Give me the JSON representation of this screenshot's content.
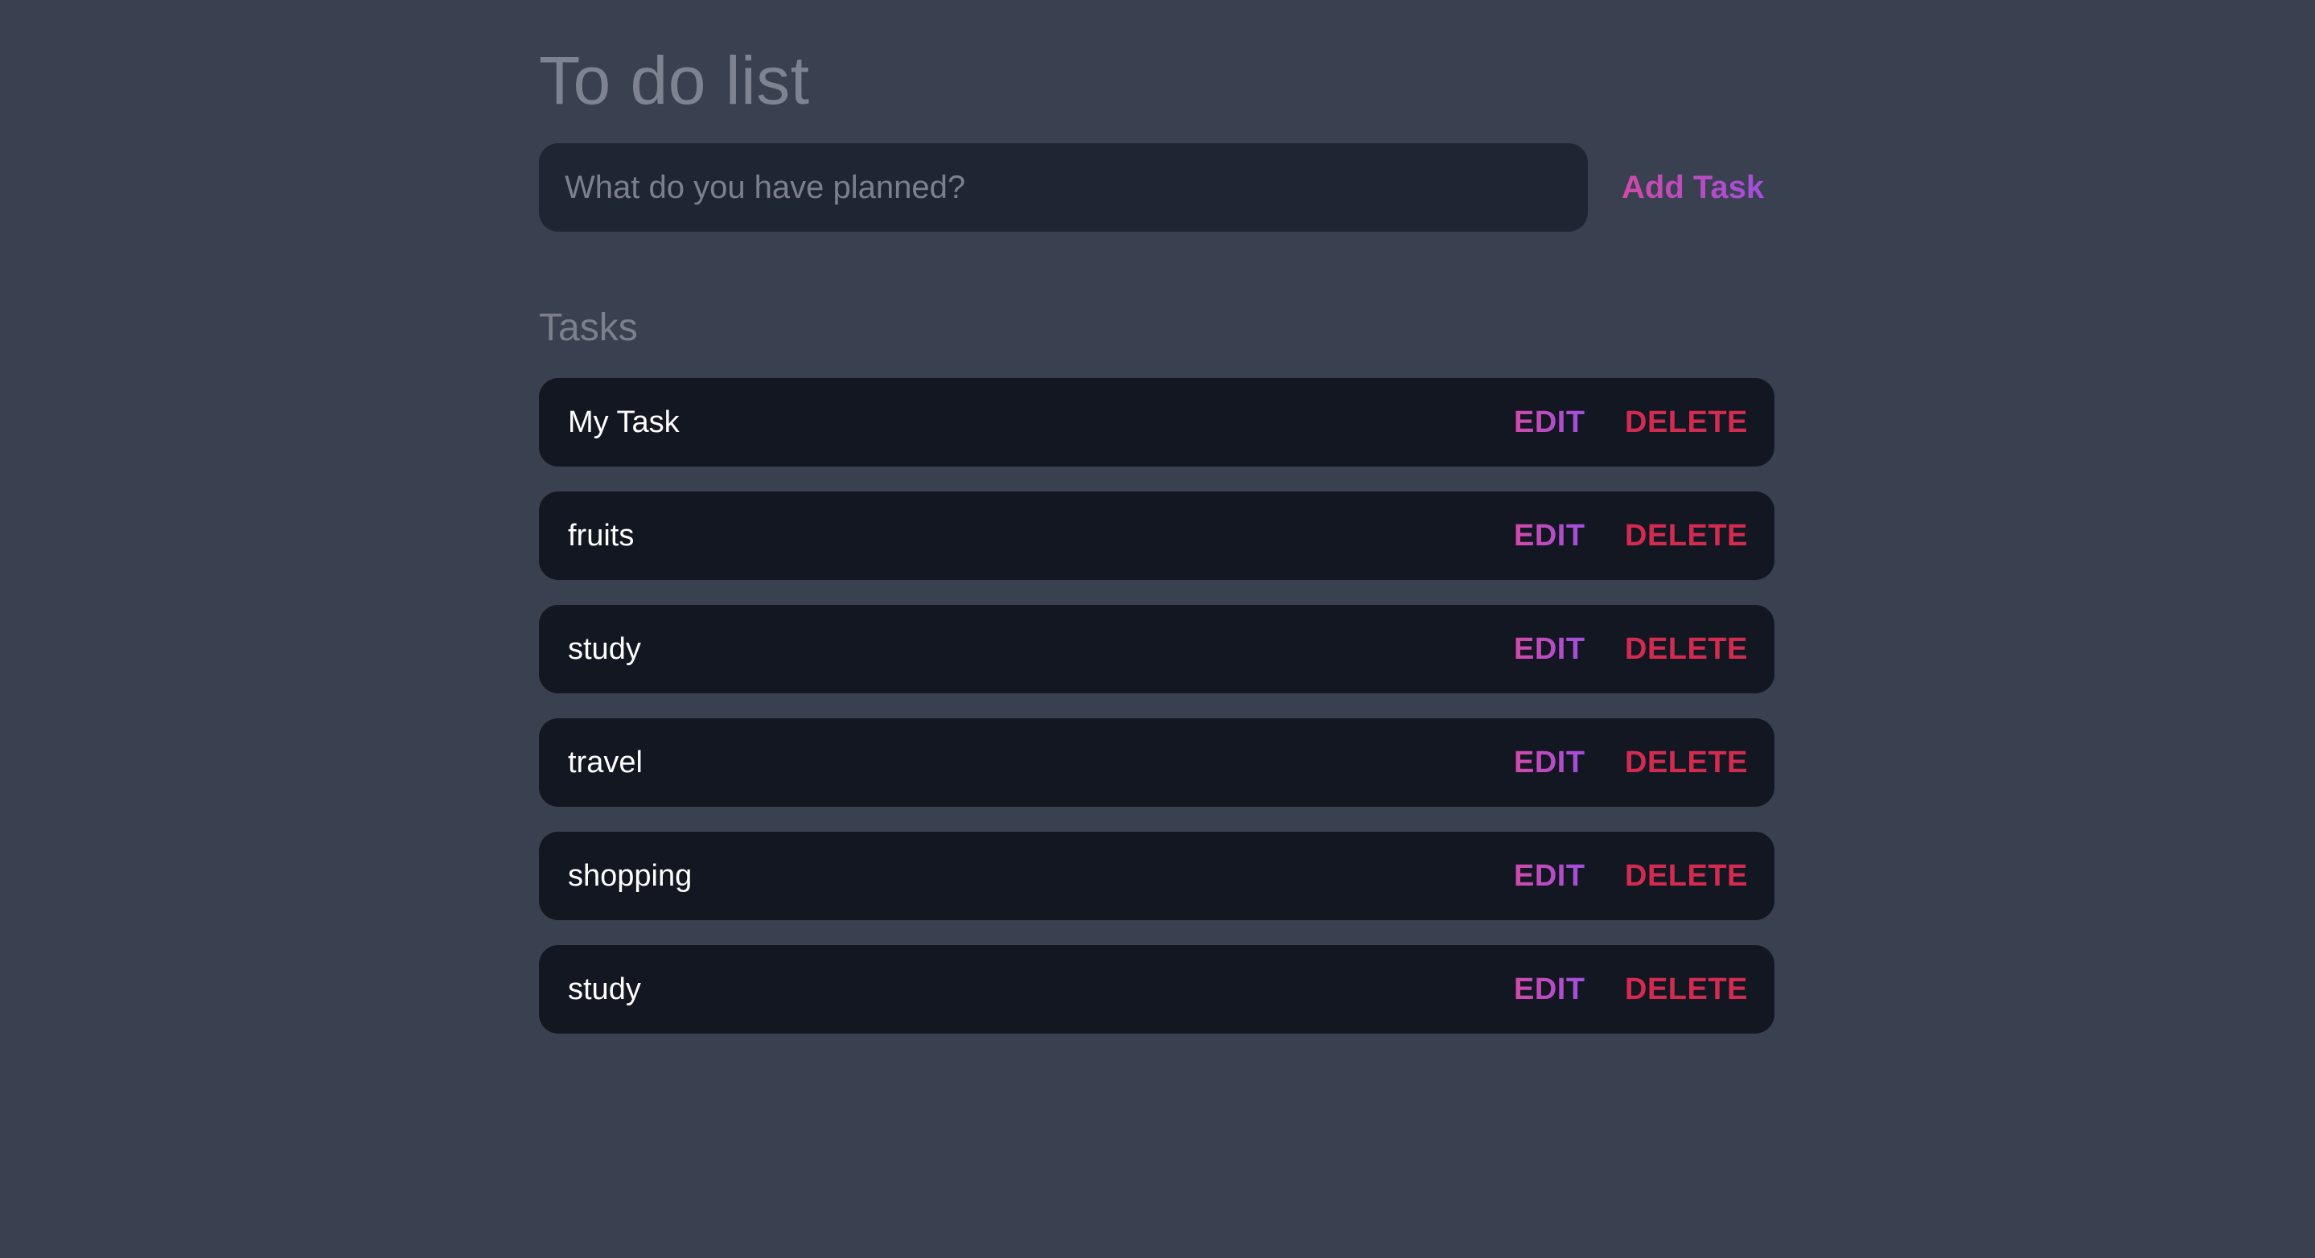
{
  "app": {
    "title": "To do list"
  },
  "new_task": {
    "placeholder": "What do you have planned?",
    "value": "",
    "add_label": "Add Task"
  },
  "tasks_section": {
    "heading": "Tasks",
    "items": [
      {
        "text": "My Task",
        "edit_label": "EDIT",
        "delete_label": "DELETE"
      },
      {
        "text": "fruits",
        "edit_label": "EDIT",
        "delete_label": "DELETE"
      },
      {
        "text": "study",
        "edit_label": "EDIT",
        "delete_label": "DELETE"
      },
      {
        "text": "travel",
        "edit_label": "EDIT",
        "delete_label": "DELETE"
      },
      {
        "text": "shopping",
        "edit_label": "EDIT",
        "delete_label": "DELETE"
      },
      {
        "text": "study",
        "edit_label": "EDIT",
        "delete_label": "DELETE"
      }
    ]
  },
  "colors": {
    "background": "#394150",
    "input_background": "#1f2633",
    "task_background": "#121722",
    "accent_gradient_start": "#d14aa8",
    "accent_gradient_end": "#a04ee0",
    "delete": "#d32b50",
    "muted_text": "#7b808c"
  }
}
